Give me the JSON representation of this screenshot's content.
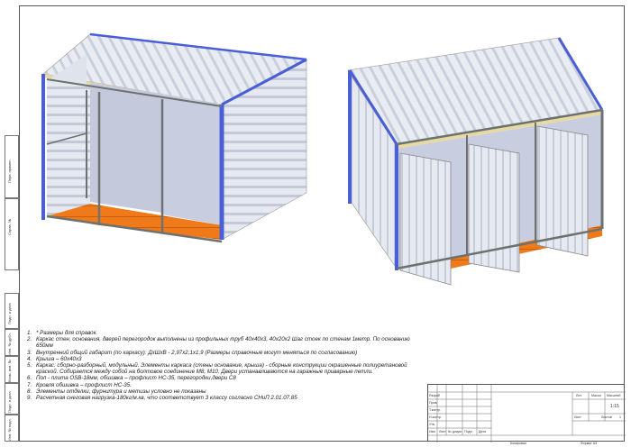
{
  "drawing": {
    "colors": {
      "wall_panel": "#e2e6ef",
      "wall_rib": "#b9c0cf",
      "frame_blue": "#4a5fd6",
      "frame_steel": "#6b7270",
      "floor_orange": "#f07a1a",
      "roof_insulation": "#e8d9a0"
    },
    "views": [
      "open-view",
      "closed-view"
    ]
  },
  "side_stamp": {
    "labels": [
      "Перв. примен.",
      "Справ. №",
      "Подп. и дата",
      "Инв. № дубл.",
      "Взам. инв. №",
      "Подп. и дата",
      "Инв. № подл."
    ]
  },
  "notes": [
    {
      "num": "1.",
      "text": "* Размеры для справок."
    },
    {
      "num": "2.",
      "text": "Каркас стен, основания, дверей перегородок выполнены из профильных труб 40х40х3, 40х20х2 Шаг стоек по стенам 1метр. По основанию 650мм"
    },
    {
      "num": "3.",
      "text": "Внутренний общий габарит (по каркасу): ДхШхВ - 2,97х2,1х1,9 (Размеры справочные могут меняться по согласованию)"
    },
    {
      "num": "4.",
      "text": "Крыша – 60х40х3"
    },
    {
      "num": "5.",
      "text": "Каркас: сборно-разборный, модульный. Элементы каркаса (стены основание, крыша) - сборные конструкции окрашенные полиуретановой краской. Собирается между собой на болтовое соединение М8, М10. Двери устанавливаются на гаражные приварные петли."
    },
    {
      "num": "6.",
      "text": "Пол - плита OSB-18мм, обшивка – профлист НС-35, перегородки,двери С8"
    },
    {
      "num": "7.",
      "text": "Кровля обшивка – профлист НС-35."
    },
    {
      "num": "8.",
      "text": "Элементы отделки, фурнитура и метизы условно не показаны"
    },
    {
      "num": "9.",
      "text": "Расчетная снеговая нагрузка-180кг/м.кв, что соответствует 3 классу согласно СНиП 2.01.07.85"
    }
  ],
  "title_block": {
    "izm": "Изм",
    "list": "Лист",
    "n_dokum": "№ докум.",
    "podp": "Подп.",
    "data": "Дата",
    "razrab": "Разраб",
    "prov": "Пров.",
    "t_kontr": "Т.контр.",
    "n_kontr": "Н.контр.",
    "utv": "Утв.",
    "lit": "Лит.",
    "massa": "Масса",
    "masshtab": "Масштаб",
    "scale_value": "1:15",
    "listov": "Листов",
    "sheet_no": "1",
    "kopiroval": "Копировал",
    "format": "Формат А3"
  }
}
